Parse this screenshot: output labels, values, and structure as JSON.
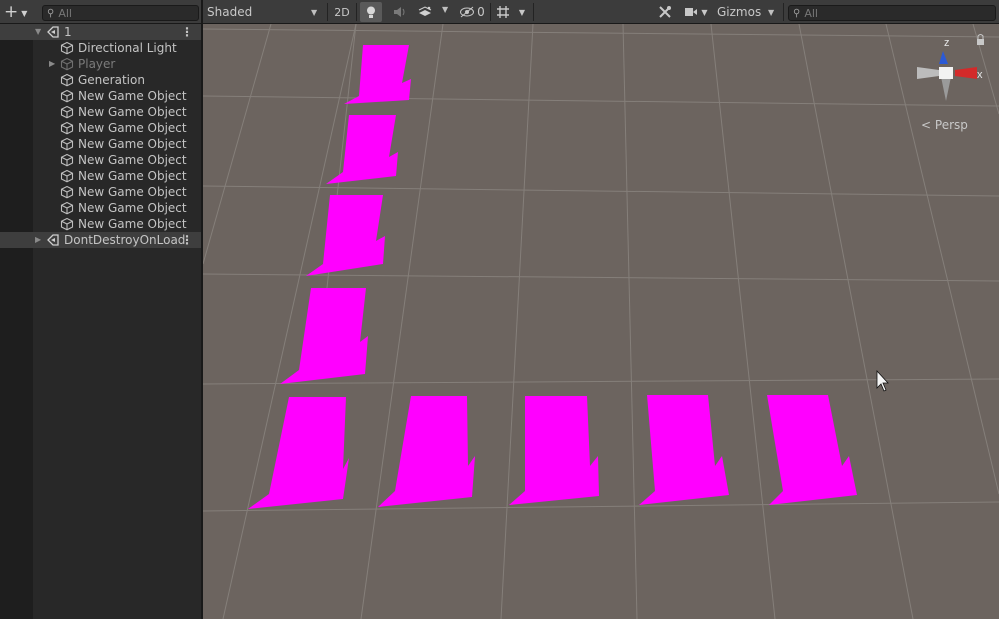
{
  "hierarchy": {
    "search_placeholder": "All",
    "scenes": [
      {
        "name": "1"
      },
      {
        "name": "DontDestroyOnLoad"
      }
    ],
    "items": [
      {
        "label": "Directional Light"
      },
      {
        "label": "Player"
      },
      {
        "label": "Generation"
      },
      {
        "label": "New Game Object"
      },
      {
        "label": "New Game Object"
      },
      {
        "label": "New Game Object"
      },
      {
        "label": "New Game Object"
      },
      {
        "label": "New Game Object"
      },
      {
        "label": "New Game Object"
      },
      {
        "label": "New Game Object"
      },
      {
        "label": "New Game Object"
      },
      {
        "label": "New Game Object"
      }
    ],
    "scene_menu_glyph": "⋮",
    "add_glyph": "+"
  },
  "scene_view": {
    "draw_mode": "Shaded",
    "mode_2d": "2D",
    "hidden_count": "0",
    "gizmos_label": "Gizmos",
    "search_placeholder": "All",
    "projection_label": "Persp",
    "axis_labels": {
      "y": "z",
      "x": "x"
    },
    "colors": {
      "background": "#6c645f",
      "grid": "#8a8580",
      "pink_object": "#ff00ff",
      "axis_x": "#d32a2a",
      "axis_z": "#2b5ad6"
    }
  },
  "icons": [
    "add-icon",
    "search-icon",
    "scene-icon",
    "gameobject-cube-icon",
    "light-icon",
    "audio-icon",
    "effects-icon",
    "visibility-icon",
    "grid-icon",
    "tools-icon",
    "camera-icon",
    "lock-icon",
    "cursor-icon"
  ]
}
